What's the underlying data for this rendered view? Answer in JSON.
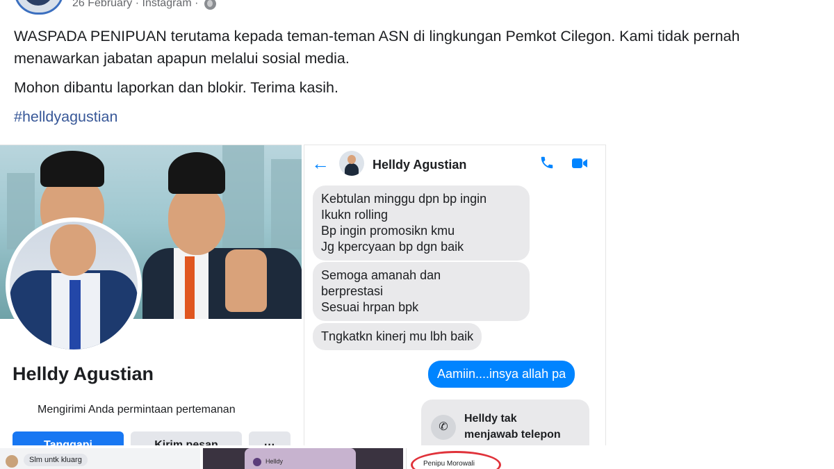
{
  "post": {
    "date": "26 February",
    "separator": "·",
    "source": "Instagram",
    "paragraph1": "WASPADA PENIPUAN terutama kepada teman-teman ASN di lingkungan Pemkot Cilegon. Kami tidak pernah menawarkan jabatan apapun melalui sosial media.",
    "paragraph2": "Mohon dibantu laporkan dan blokir. Terima kasih.",
    "hashtag": "#helldyagustian"
  },
  "profile_card": {
    "name": "Helldy Agustian",
    "subtitle": "Mengirimi Anda permintaan pertemanan",
    "primary_button": "Tanggapi",
    "secondary_button": "Kirim pesan",
    "more_button": "···"
  },
  "messenger": {
    "contact_name": "Helldy Agustian",
    "messages": [
      {
        "from": "them",
        "text": "Kebtulan minggu dpn bp ingin\nIkukn rolling\nBp ingin promosikn kmu\nJg kpercyaan bp dgn baik"
      },
      {
        "from": "them",
        "text": "Semoga amanah dan\nberprestasi\nSesuai hrpan bpk"
      },
      {
        "from": "them",
        "text": "Tngkatkn kinerj mu lbh baik"
      },
      {
        "from": "me",
        "text": "Aamiin....insya allah pa"
      }
    ],
    "missed_call": "Helldy tak\nmenjawab telepon"
  },
  "thumbnails": {
    "t1_text": "Slm untk kluarg",
    "t2_text": "Helldy",
    "t3_text": "Penipu Morowali"
  },
  "icons": [
    "globe-icon",
    "back-arrow-icon",
    "phone-icon",
    "video-call-icon",
    "missed-call-icon"
  ],
  "colors": {
    "accent": "#1877f2",
    "messenger_blue": "#0084ff",
    "hashtag": "#385898"
  }
}
